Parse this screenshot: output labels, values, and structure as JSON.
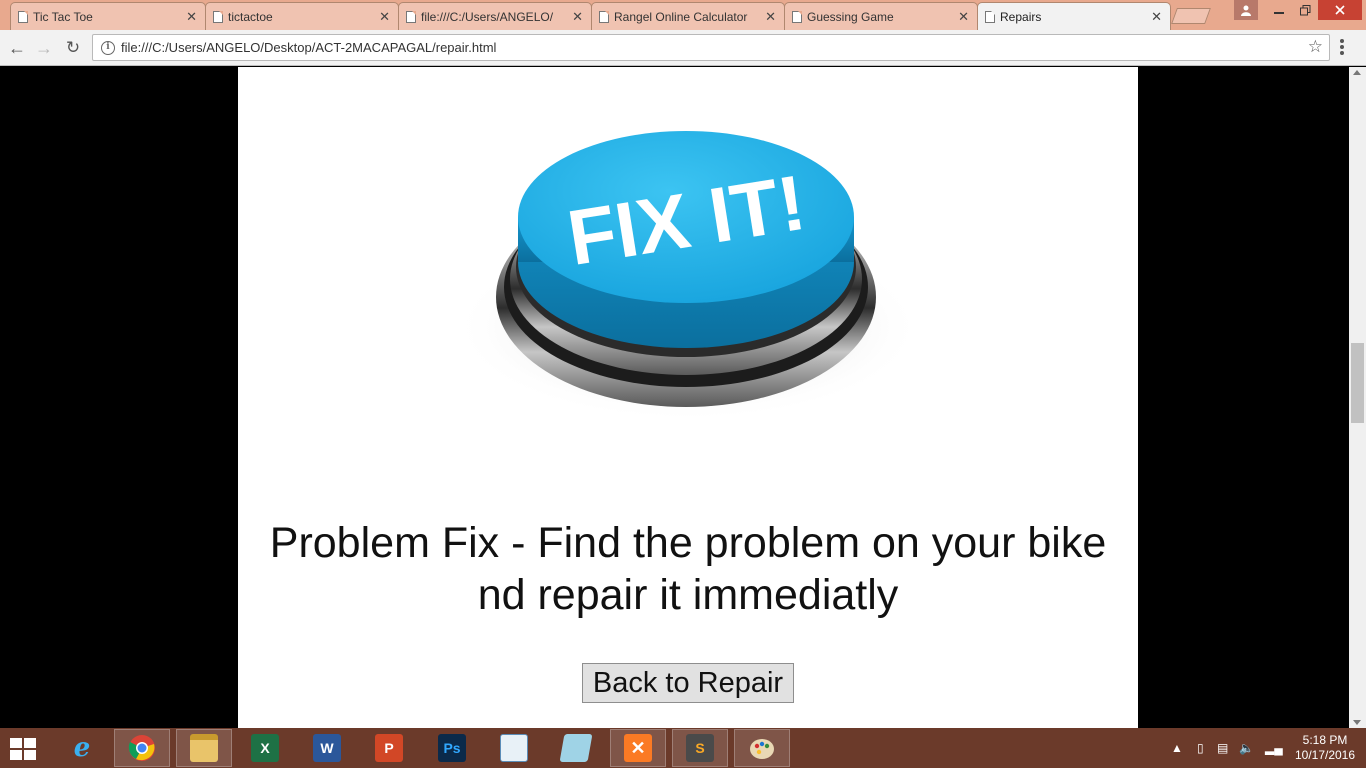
{
  "browser": {
    "tabs": [
      {
        "label": "Tic Tac Toe",
        "active": false
      },
      {
        "label": "tictactoe",
        "active": false
      },
      {
        "label": "file:///C:/Users/ANGELO/",
        "active": false
      },
      {
        "label": "Rangel Online Calculator",
        "active": false
      },
      {
        "label": "Guessing Game",
        "active": false
      },
      {
        "label": "Repairs",
        "active": true
      }
    ],
    "url": "file:///C:/Users/ANGELO/Desktop/ACT-2MACAPAGAL/repair.html"
  },
  "page": {
    "hero_image_text": "FIX IT!",
    "heading": "Problem Fix - Find the problem on your bike nd repair it immediatly",
    "back_button_label": "Back to Repair"
  },
  "taskbar": {
    "apps": [
      {
        "name": "internet-explorer",
        "running": false
      },
      {
        "name": "chrome",
        "running": true
      },
      {
        "name": "file-explorer",
        "running": true
      },
      {
        "name": "excel",
        "running": false
      },
      {
        "name": "word",
        "running": false
      },
      {
        "name": "powerpoint",
        "running": false
      },
      {
        "name": "photoshop",
        "running": false
      },
      {
        "name": "mysql-installer",
        "running": false
      },
      {
        "name": "notepad",
        "running": false
      },
      {
        "name": "xampp",
        "running": true
      },
      {
        "name": "sublime-text",
        "running": true
      },
      {
        "name": "paint",
        "running": true
      }
    ],
    "time": "5:18 PM",
    "date": "10/17/2016"
  },
  "colors": {
    "tab_strip": "#e8a98e",
    "taskbar": "#6b3a2a",
    "button_blue": "#1aa6df"
  }
}
